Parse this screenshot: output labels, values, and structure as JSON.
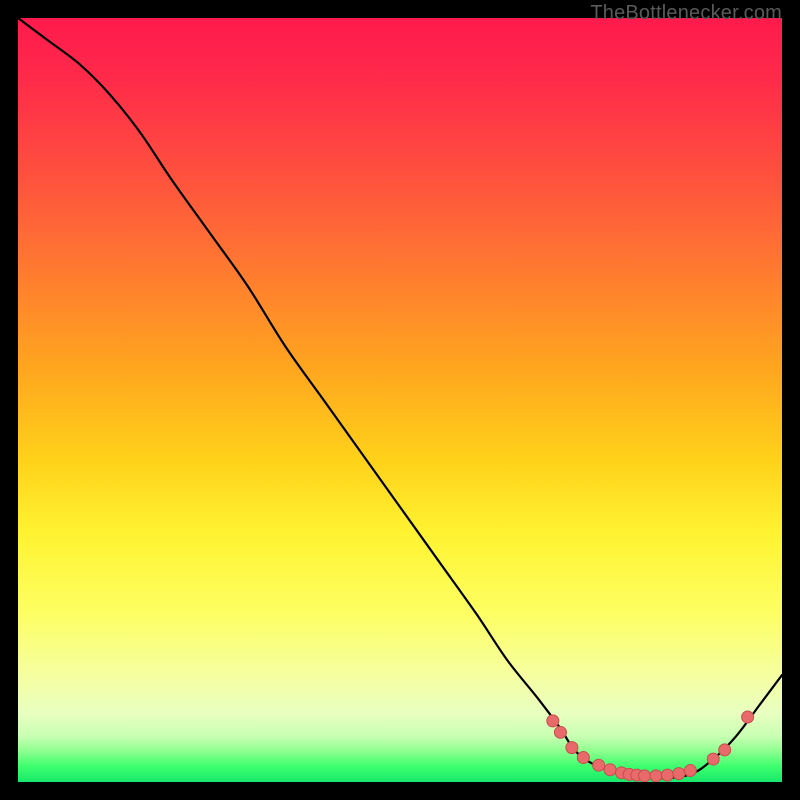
{
  "source_label": "TheBottlenecker.com",
  "colors": {
    "page_bg": "#000000",
    "curve": "#000000",
    "marker": "#e86a6a",
    "marker_stroke": "#c74e4e"
  },
  "chart_data": {
    "type": "line",
    "title": "",
    "xlabel": "",
    "ylabel": "",
    "xlim": [
      0,
      100
    ],
    "ylim": [
      0,
      100
    ],
    "grid": false,
    "legend": false,
    "note": "Axes are unlabeled; values estimated from pixel positions. Curve descends steeply from top-left, bottoms out in a flat trough near x≈73–88 at y≈0–2, then rises toward the right edge.",
    "series": [
      {
        "name": "curve",
        "x": [
          0,
          4,
          8,
          12,
          16,
          20,
          25,
          30,
          35,
          40,
          45,
          50,
          55,
          60,
          64,
          68,
          71,
          73,
          76,
          80,
          84,
          88,
          91,
          94,
          97,
          100
        ],
        "y": [
          100,
          97,
          94,
          90,
          85,
          79,
          72,
          65,
          57,
          50,
          43,
          36,
          29,
          22,
          16,
          11,
          7,
          4,
          2,
          1,
          0.5,
          1,
          3,
          6,
          10,
          14
        ]
      }
    ],
    "markers": {
      "name": "highlight-points",
      "points": [
        {
          "x": 70.0,
          "y": 8.0
        },
        {
          "x": 71.0,
          "y": 6.5
        },
        {
          "x": 72.5,
          "y": 4.5
        },
        {
          "x": 74.0,
          "y": 3.2
        },
        {
          "x": 76.0,
          "y": 2.2
        },
        {
          "x": 77.5,
          "y": 1.6
        },
        {
          "x": 79.0,
          "y": 1.2
        },
        {
          "x": 80.0,
          "y": 1.0
        },
        {
          "x": 81.0,
          "y": 0.9
        },
        {
          "x": 82.0,
          "y": 0.8
        },
        {
          "x": 83.5,
          "y": 0.8
        },
        {
          "x": 85.0,
          "y": 0.9
        },
        {
          "x": 86.5,
          "y": 1.1
        },
        {
          "x": 88.0,
          "y": 1.5
        },
        {
          "x": 91.0,
          "y": 3.0
        },
        {
          "x": 92.5,
          "y": 4.2
        },
        {
          "x": 95.5,
          "y": 8.5
        }
      ]
    }
  }
}
